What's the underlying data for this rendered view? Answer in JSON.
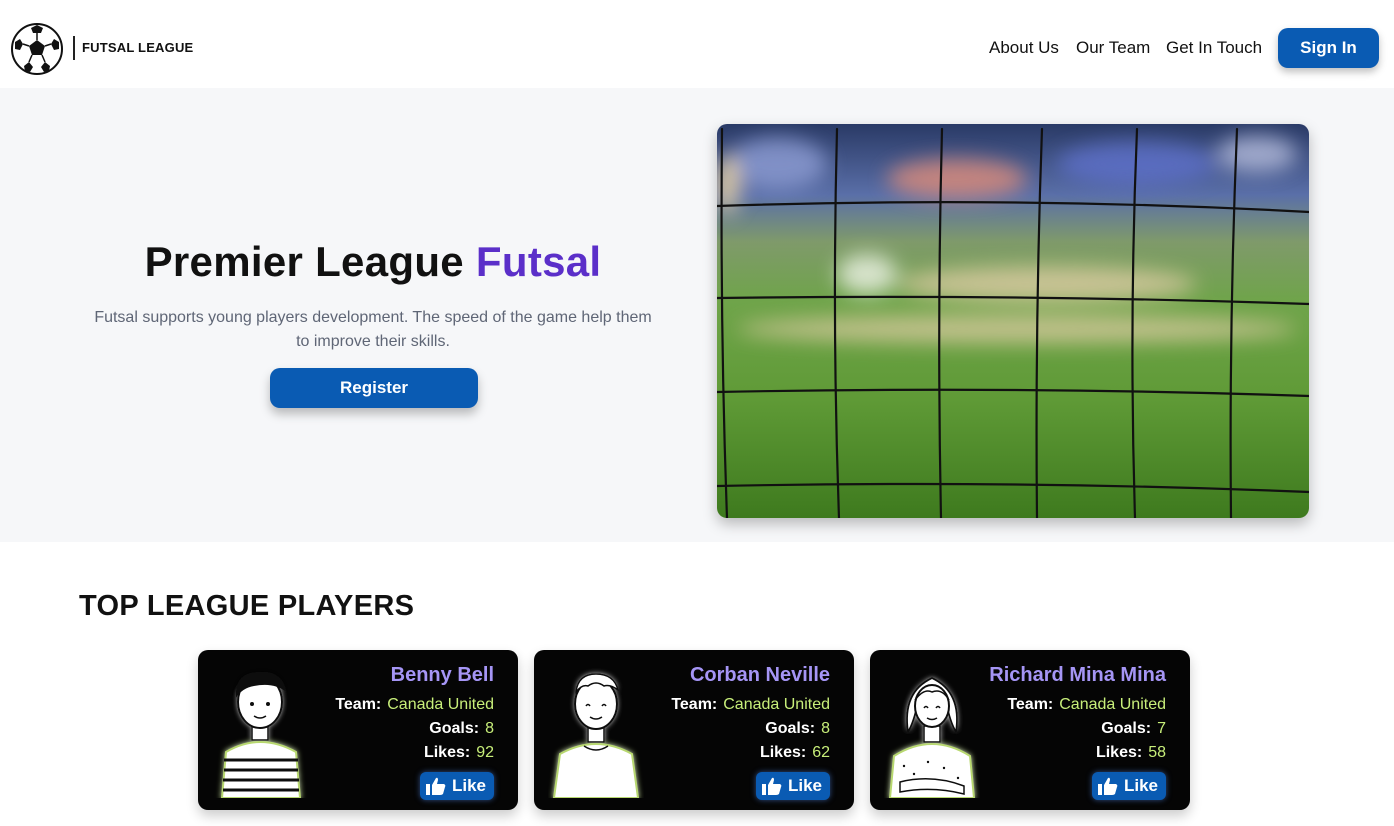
{
  "header": {
    "brand": "FUTSAL LEAGUE",
    "nav": [
      "About Us",
      "Our Team",
      "Get In Touch"
    ],
    "signin_label": "Sign In"
  },
  "hero": {
    "title_main": "Premier League ",
    "title_accent": "Futsal",
    "description": "Futsal supports young players development. The speed of the game help them to improve their skills.",
    "register_label": "Register",
    "image_icon": "soccer-goal-net-photo"
  },
  "players_section": {
    "title": "TOP LEAGUE PLAYERS",
    "labels": {
      "team": "Team:",
      "goals": "Goals:",
      "likes": "Likes:",
      "like_button": "Like"
    },
    "players": [
      {
        "name": "Benny Bell",
        "team": "Canada United",
        "goals": "8",
        "likes": "92",
        "avatar_icon": "boy-striped-shirt-avatar"
      },
      {
        "name": "Corban Neville",
        "team": "Canada United",
        "goals": "8",
        "likes": "62",
        "avatar_icon": "boy-tshirt-avatar"
      },
      {
        "name": "Richard Mina Mina",
        "team": "Canada United",
        "goals": "7",
        "likes": "58",
        "avatar_icon": "girl-sweater-avatar"
      }
    ]
  },
  "colors": {
    "primary": "#0a5bb3",
    "accent": "#5b2fc9",
    "card_name": "#a595f5",
    "card_value": "#c8ef7a",
    "card_bg": "#050505"
  }
}
